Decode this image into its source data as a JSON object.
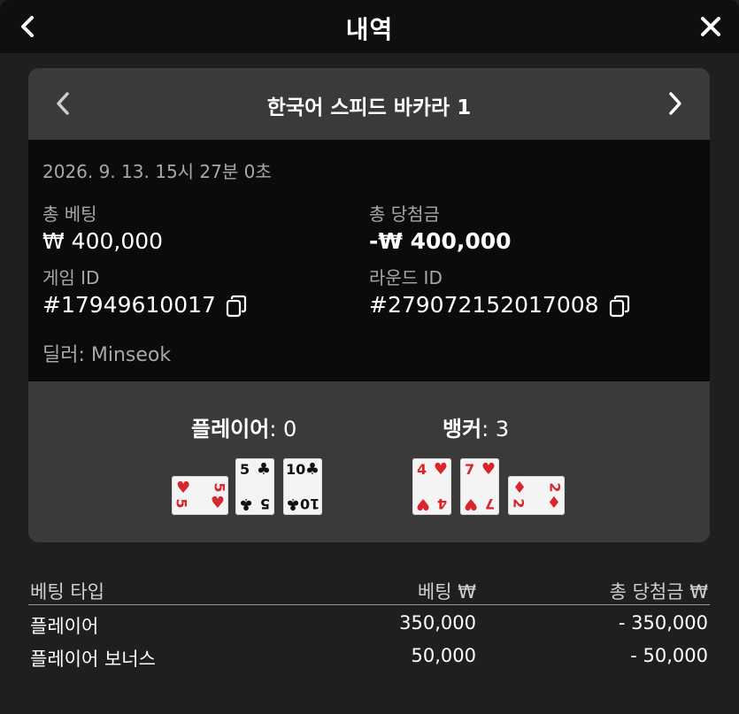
{
  "header": {
    "title": "내역",
    "back_icon": "chevron-left-icon",
    "close_icon": "close-icon"
  },
  "game": {
    "name": "한국어 스피드 바카라 1",
    "prev_icon": "chevron-left-icon",
    "next_icon": "chevron-right-icon"
  },
  "details": {
    "datetime": "2026. 9. 13. 15시 27분 0초",
    "total_bet_label": "총 베팅",
    "total_bet_value": "₩ 400,000",
    "total_win_label": "총 당첨금",
    "total_win_value": "-₩ 400,000",
    "game_id_label": "게임 ID",
    "game_id_value": "#17949610017",
    "round_id_label": "라운드 ID",
    "round_id_value": "#279072152017008",
    "dealer": "딜러: Minseok"
  },
  "result": {
    "player_label": "플레이어",
    "player_score_text": ": 0",
    "banker_label": "뱅커",
    "banker_score_text": ": 3",
    "player_cards": [
      {
        "rank": "5",
        "suit": "♥",
        "color": "#d9262d",
        "rotated": true
      },
      {
        "rank": "5",
        "suit": "♣",
        "color": "#111111",
        "rotated": false
      },
      {
        "rank": "10",
        "suit": "♣",
        "color": "#111111",
        "rotated": false
      }
    ],
    "banker_cards": [
      {
        "rank": "4",
        "suit": "♥",
        "color": "#d9262d",
        "rotated": false
      },
      {
        "rank": "7",
        "suit": "♥",
        "color": "#d9262d",
        "rotated": false
      },
      {
        "rank": "2",
        "suit": "♦",
        "color": "#d9262d",
        "rotated": true
      }
    ]
  },
  "bets": {
    "headers": {
      "type": "베팅 타입",
      "bet": "베팅 ₩",
      "win": "총 당첨금 ₩"
    },
    "rows": [
      {
        "type": "플레이어",
        "bet": "350,000",
        "win": "- 350,000"
      },
      {
        "type": "플레이어 보너스",
        "bet": "50,000",
        "win": "- 50,000"
      }
    ]
  },
  "colors": {
    "background": "#1f1f1f",
    "card_bg": "#3a3a3a",
    "info_bg": "#0b0b0b",
    "label_gray": "#a8a8a8",
    "suit_red": "#d9262d"
  }
}
